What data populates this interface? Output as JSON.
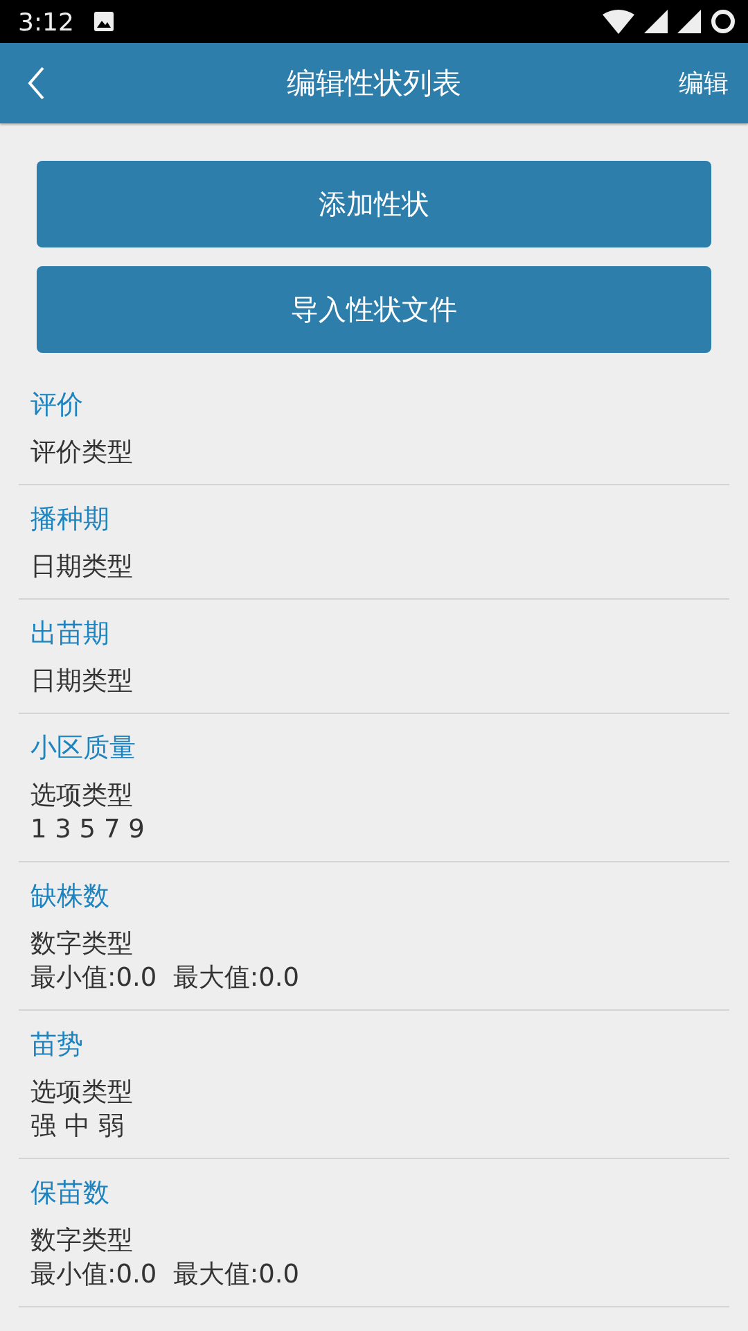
{
  "status_bar": {
    "time": "3:12"
  },
  "app_bar": {
    "title": "编辑性状列表",
    "action": "编辑"
  },
  "buttons": [
    "添加性状",
    "导入性状文件"
  ],
  "traits": [
    {
      "name": "评价",
      "type": "评价类型"
    },
    {
      "name": "播种期",
      "type": "日期类型"
    },
    {
      "name": "出苗期",
      "type": "日期类型"
    },
    {
      "name": "小区质量",
      "type": "选项类型",
      "detail": "1 3 5 7 9"
    },
    {
      "name": "缺株数",
      "type": "数字类型",
      "detail": "最小值:0.0  最大值:0.0"
    },
    {
      "name": "苗势",
      "type": "选项类型",
      "detail": "强 中 弱"
    },
    {
      "name": "保苗数",
      "type": "数字类型",
      "detail": "最小值:0.0  最大值:0.0"
    }
  ]
}
